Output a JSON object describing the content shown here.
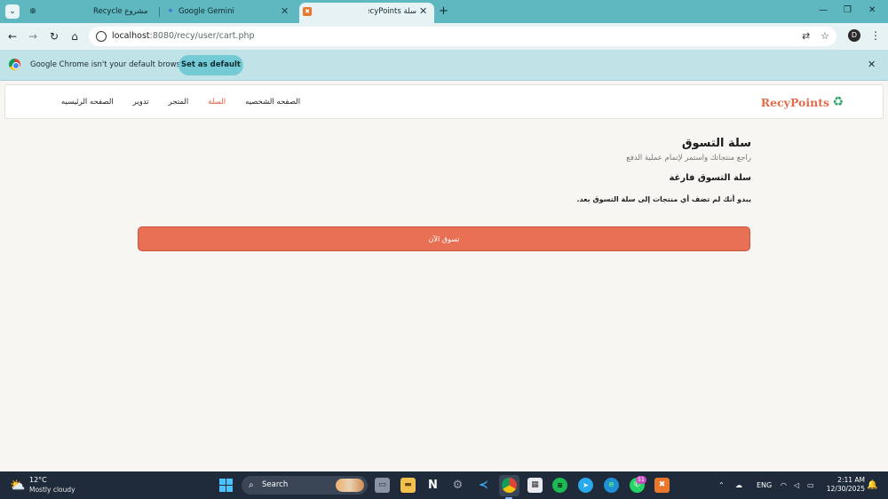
{
  "browser": {
    "tabs": [
      {
        "title": "مشروع Recycle",
        "favicon": "globe-icon",
        "active": false
      },
      {
        "title": "Google Gemini",
        "favicon": "gemini-icon",
        "active": false
      },
      {
        "title": "سلة RecyPoints",
        "favicon": "xampp-icon",
        "active": true
      }
    ],
    "new_tab": "+",
    "window_controls": {
      "minimize": "—",
      "restore": "❐",
      "close": "✕"
    },
    "url_host": "localhost",
    "url_rest": ":8080/recy/user/cart.php",
    "infobar": {
      "message": "Google Chrome isn't your default browser",
      "button": "Set as default"
    },
    "profile_initial": "D"
  },
  "site": {
    "brand": "RecyPoints",
    "brand_color": "#e06c4c",
    "nav": [
      {
        "label": "الصفحه الرئيسيه",
        "active": false
      },
      {
        "label": "تدوير",
        "active": false
      },
      {
        "label": "المتجر",
        "active": false
      },
      {
        "label": "السلة",
        "active": true
      },
      {
        "label": "الصفحه الشخصيه",
        "active": false
      }
    ],
    "accent_color": "#e87055"
  },
  "cart": {
    "title": "سلة التسوق",
    "subtitle": "راجع منتجاتك واستمر لإتمام عملية الدفع",
    "empty_title": "سلة التسوق فارغة",
    "empty_message": "يبدو أنك لم تضف أي منتجات إلى سلة التسوق بعد.",
    "shop_button": "تسوق الآن"
  },
  "taskbar": {
    "temperature": "12°C",
    "weather": "Mostly cloudy",
    "search_label": "Search",
    "language": "ENG",
    "time": "2:11 AM",
    "date": "12/30/2025",
    "whatsapp_badge": "51",
    "chrome_badge": "D"
  }
}
